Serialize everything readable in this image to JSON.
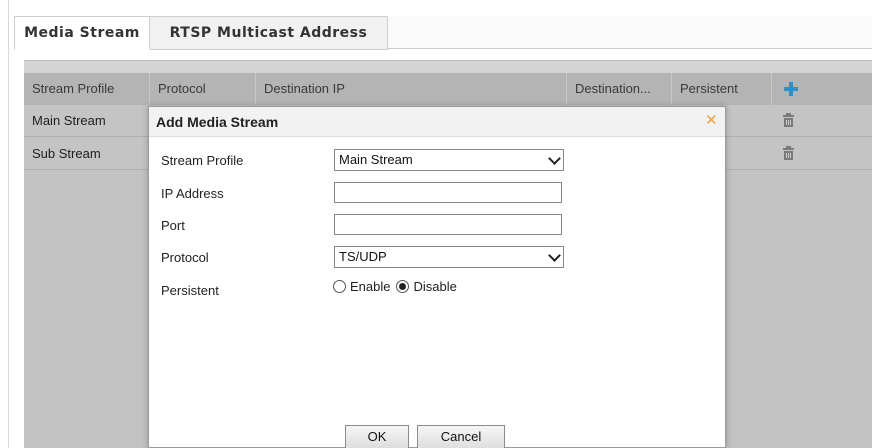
{
  "tabs": [
    {
      "label": "Media Stream",
      "active": true
    },
    {
      "label": "RTSP Multicast Address",
      "active": false
    }
  ],
  "table": {
    "headers": [
      "Stream Profile",
      "Protocol",
      "Destination IP",
      "Destination...",
      "Persistent"
    ],
    "add_icon": "plus-icon",
    "rows": [
      {
        "name": "Main Stream",
        "delete_icon": "trash-icon"
      },
      {
        "name": "Sub Stream",
        "delete_icon": "trash-icon"
      }
    ]
  },
  "dialog": {
    "title": "Add Media Stream",
    "close_icon": "close-icon",
    "fields": {
      "stream_profile": {
        "label": "Stream Profile",
        "value": "Main Stream"
      },
      "ip_address": {
        "label": "IP Address",
        "value": ""
      },
      "port": {
        "label": "Port",
        "value": ""
      },
      "protocol": {
        "label": "Protocol",
        "value": "TS/UDP"
      },
      "persistent": {
        "label": "Persistent",
        "options": [
          "Enable",
          "Disable"
        ],
        "selected": "Disable"
      }
    },
    "buttons": {
      "ok": "OK",
      "cancel": "Cancel"
    }
  },
  "colors": {
    "accent": "#2f8fc9",
    "close": "#f2a33a"
  }
}
